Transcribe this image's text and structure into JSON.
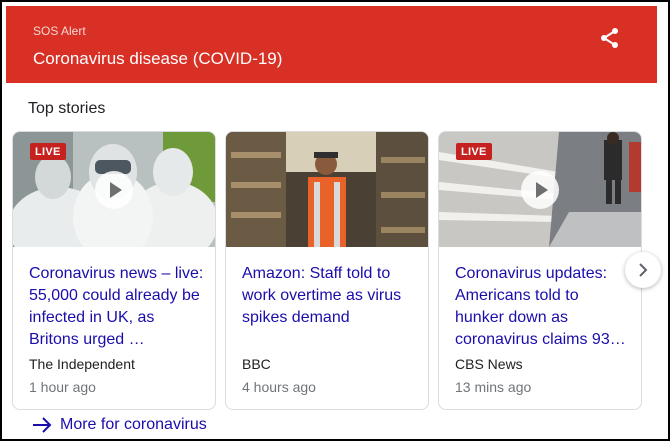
{
  "sos": {
    "label": "SOS Alert",
    "title": "Coronavirus disease (COVID-19)",
    "share_icon": "share-icon",
    "header_color": "#d93025"
  },
  "top_stories": {
    "title": "Top stories",
    "cards": [
      {
        "live": "LIVE",
        "has_video": true,
        "headline": "Coronavirus news – live: 55,000 could already be infected in UK, as Britons urged …",
        "source": "The Independent",
        "time": "1 hour ago"
      },
      {
        "live": "",
        "has_video": false,
        "headline": "Amazon: Staff told to work overtime as virus spikes demand",
        "source": "BBC",
        "time": "4 hours ago"
      },
      {
        "live": "LIVE",
        "has_video": true,
        "headline": "Coronavirus updates: Americans told to hunker down as coronavirus claims 93…",
        "source": "CBS News",
        "time": "13 mins ago"
      }
    ],
    "next_icon": "chevron-right-icon"
  },
  "more": {
    "label": "More for coronavirus",
    "icon": "arrow-right-icon"
  },
  "colors": {
    "link": "#1a0dab",
    "live_badge": "#c5221f"
  }
}
